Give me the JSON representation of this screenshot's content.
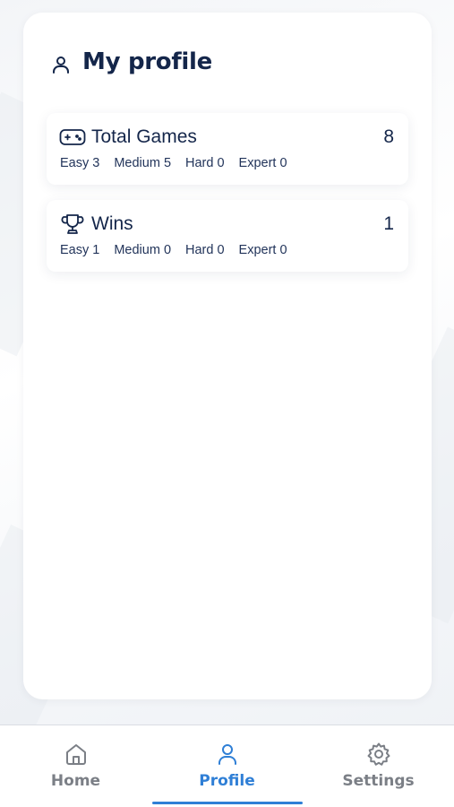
{
  "profile": {
    "title": "My profile"
  },
  "stats": {
    "total_games": {
      "title": "Total Games",
      "count": "8",
      "easy": "Easy 3",
      "medium": "Medium 5",
      "hard": "Hard 0",
      "expert": "Expert 0"
    },
    "wins": {
      "title": "Wins",
      "count": "1",
      "easy": "Easy 1",
      "medium": "Medium 0",
      "hard": "Hard 0",
      "expert": "Expert 0"
    }
  },
  "tabbar": {
    "tabs": [
      {
        "label": "Home",
        "icon": "home-icon",
        "active": false
      },
      {
        "label": "Profile",
        "icon": "user-icon",
        "active": true
      },
      {
        "label": "Settings",
        "icon": "gear-icon",
        "active": false
      }
    ]
  },
  "colors": {
    "primary_text": "#14264a",
    "accent": "#2f7fd6",
    "inactive": "#7b7f86"
  }
}
